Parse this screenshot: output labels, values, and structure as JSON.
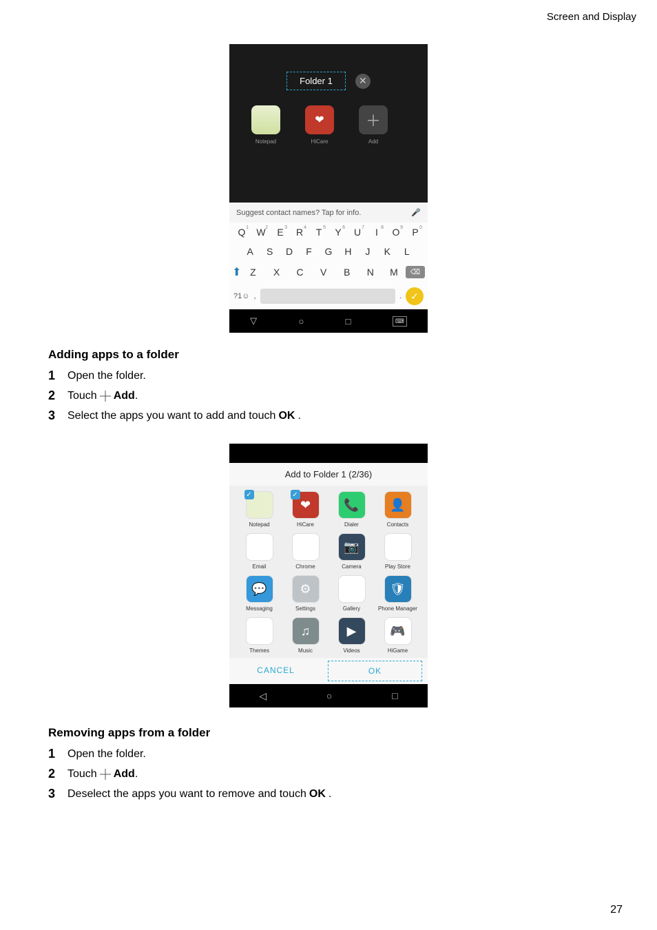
{
  "header": {
    "right_text": "Screen and Display"
  },
  "page_number": "27",
  "section1": {
    "heading": "Adding apps to a folder",
    "steps": [
      "Open the folder.",
      {
        "prefix": "Touch ",
        "bold_after_icon": "Add",
        "suffix": "."
      },
      {
        "prefix": "Select the apps you want to add and touch ",
        "bold": "OK",
        "suffix": "."
      }
    ]
  },
  "section2": {
    "heading": "Removing apps from a folder",
    "steps": [
      "Open the folder.",
      {
        "prefix": "Touch ",
        "bold_after_icon": "Add",
        "suffix": "."
      },
      {
        "prefix": "Deselect the apps you want to remove and touch ",
        "bold": "OK",
        "suffix": "."
      }
    ]
  },
  "screenshot1": {
    "folder_title": "Folder 1",
    "apps": [
      {
        "label": "Notepad"
      },
      {
        "label": "HiCare"
      },
      {
        "label": "Add"
      }
    ],
    "suggest_text": "Suggest contact names? Tap for info.",
    "kb_row1": [
      "Q",
      "W",
      "E",
      "R",
      "T",
      "Y",
      "U",
      "I",
      "O",
      "P"
    ],
    "kb_row1_sup": [
      "1",
      "2",
      "3",
      "4",
      "5",
      "6",
      "7",
      "8",
      "9",
      "0"
    ],
    "kb_row2": [
      "A",
      "S",
      "D",
      "F",
      "G",
      "H",
      "J",
      "K",
      "L"
    ],
    "kb_row3": [
      "Z",
      "X",
      "C",
      "V",
      "B",
      "N",
      "M"
    ],
    "kb_sym": "?1☺",
    "kb_comma": ",",
    "kb_period": "."
  },
  "screenshot2": {
    "title": "Add to Folder 1 (2/36)",
    "apps": [
      {
        "label": "Notepad",
        "checked": true,
        "bg": "#e8f0d0",
        "glyph": ""
      },
      {
        "label": "HiCare",
        "checked": true,
        "bg": "#c0392b",
        "glyph": "❤"
      },
      {
        "label": "Dialer",
        "bg": "#2ecc71",
        "glyph": "📞"
      },
      {
        "label": "Contacts",
        "bg": "#e67e22",
        "glyph": "👤"
      },
      {
        "label": "Email",
        "bg": "#ffffff",
        "glyph": "✉"
      },
      {
        "label": "Chrome",
        "bg": "#ffffff",
        "glyph": "◯"
      },
      {
        "label": "Camera",
        "bg": "#34495e",
        "glyph": "📷"
      },
      {
        "label": "Play Store",
        "bg": "#ffffff",
        "glyph": "▶"
      },
      {
        "label": "Messaging",
        "bg": "#3498db",
        "glyph": "💬"
      },
      {
        "label": "Settings",
        "bg": "#bdc3c7",
        "glyph": "⚙"
      },
      {
        "label": "Gallery",
        "bg": "#ffffff",
        "glyph": "🖼"
      },
      {
        "label": "Phone Manager",
        "bg": "#2980b9",
        "glyph": "🛡"
      },
      {
        "label": "Themes",
        "bg": "#ffffff",
        "glyph": "❀"
      },
      {
        "label": "Music",
        "bg": "#7f8c8d",
        "glyph": "♫"
      },
      {
        "label": "Videos",
        "bg": "#34495e",
        "glyph": "▶"
      },
      {
        "label": "HiGame",
        "bg": "#ffffff",
        "glyph": "🎮"
      }
    ],
    "cancel": "CANCEL",
    "ok": "OK"
  }
}
